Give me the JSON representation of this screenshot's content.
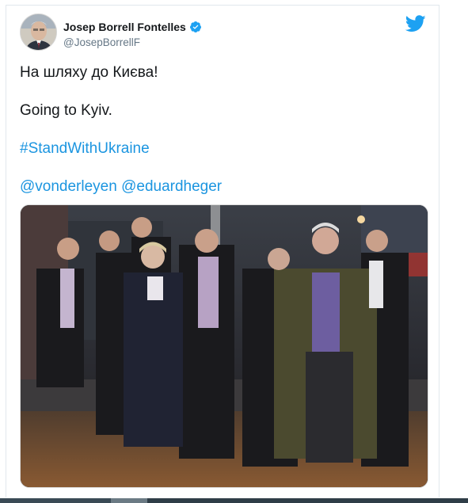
{
  "tweet": {
    "display_name": "Josep Borrell Fontelles",
    "handle": "@JosepBorrellF",
    "lines": [
      "На шляху до Києва!",
      "Going to Kyiv.",
      "#StandWithUkraine",
      "@vonderleyen @eduardheger"
    ],
    "mentions": [
      "@vonderleyen",
      "@eduardheger"
    ],
    "hashtag": "#StandWithUkraine"
  },
  "icons": {
    "verified": "verified-badge-icon",
    "brand": "twitter-bird-icon"
  },
  "colors": {
    "link": "#1b95e0",
    "text": "#14171a",
    "secondary": "#657786",
    "brand": "#1da1f2"
  }
}
